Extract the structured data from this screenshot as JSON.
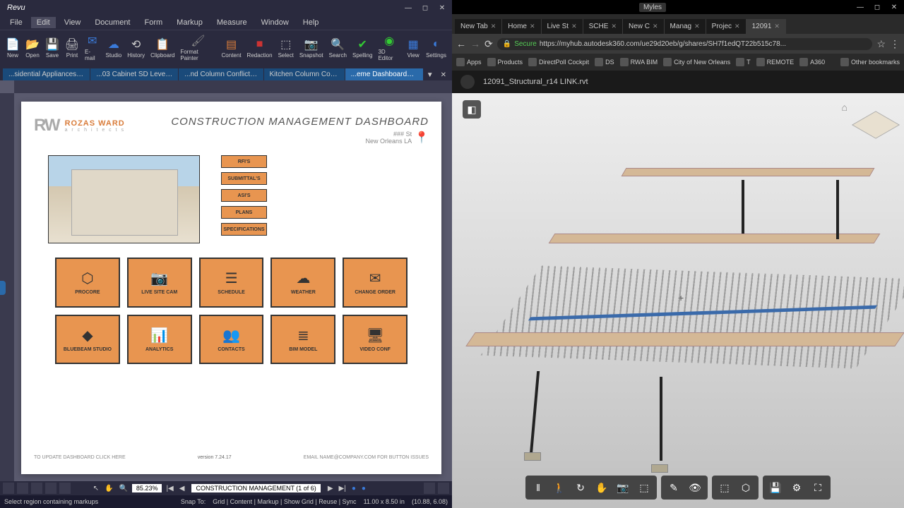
{
  "revu": {
    "app": "Revu",
    "menu": [
      "File",
      "Edit",
      "View",
      "Document",
      "Form",
      "Markup",
      "Measure",
      "Window",
      "Help"
    ],
    "toolbar": [
      {
        "label": "New",
        "icon": "📄",
        "color": "#ffcc33"
      },
      {
        "label": "Open",
        "icon": "📂",
        "color": "#d97c3a"
      },
      {
        "label": "Save",
        "icon": "💾",
        "color": "#3a7ad9"
      },
      {
        "label": "Print",
        "icon": "🖨",
        "color": "#ccc"
      },
      {
        "label": "E-mail",
        "icon": "✉",
        "color": "#3a7ad9"
      },
      {
        "label": "Studio",
        "icon": "☁",
        "color": "#3a7ad9"
      },
      {
        "label": "History",
        "icon": "⟲",
        "color": "#ccc"
      },
      {
        "label": "Clipboard",
        "icon": "📋",
        "color": "#d97c3a"
      },
      {
        "label": "Format Painter",
        "icon": "🖌",
        "color": "#888"
      },
      {
        "label": "Content",
        "icon": "▤",
        "color": "#d97c3a"
      },
      {
        "label": "Redaction",
        "icon": "■",
        "color": "#c33"
      },
      {
        "label": "Select",
        "icon": "⬚",
        "color": "#ccc"
      },
      {
        "label": "Snapshot",
        "icon": "📷",
        "color": "#3a7ad9"
      },
      {
        "label": "Search",
        "icon": "🔍",
        "color": "#3a7ad9"
      },
      {
        "label": "Spelling",
        "icon": "✔",
        "color": "#3c3"
      },
      {
        "label": "3D Editor",
        "icon": "◉",
        "color": "#3c3"
      },
      {
        "label": "View",
        "icon": "▦",
        "color": "#3a7ad9"
      },
      {
        "label": "Settings",
        "icon": "◐",
        "color": "#3a7ad9"
      }
    ],
    "tabs": [
      "...sidential Appliances PD*",
      "...03 Cabinet SD Level 2-5",
      "...nd Column Conflict _1_",
      "Kitchen Column Conflict",
      "...eme Dashboards_LI*"
    ],
    "active_tab": 4,
    "dashboard": {
      "logo_name": "ROZAS WARD",
      "logo_sub": "a r c h i t e c t s",
      "title": "CONSTRUCTION MANAGEMENT DASHBOARD",
      "addr1": "### St",
      "addr2": "New Orleans LA",
      "links": [
        "RFI'S",
        "SUBMITTAL'S",
        "ASI'S",
        "PLANS",
        "SPECIFICATIONS"
      ],
      "cards": [
        {
          "label": "PROCORE",
          "icon": "⬡"
        },
        {
          "label": "LIVE SITE CAM",
          "icon": "📷"
        },
        {
          "label": "SCHEDULE",
          "icon": "☰"
        },
        {
          "label": "WEATHER",
          "icon": "☁"
        },
        {
          "label": "CHANGE ORDER",
          "icon": "✉"
        },
        {
          "label": "BLUEBEAM STUDIO",
          "icon": "◆"
        },
        {
          "label": "ANALYTICS",
          "icon": "📊"
        },
        {
          "label": "CONTACTS",
          "icon": "👥"
        },
        {
          "label": "BIM MODEL",
          "icon": "≣"
        },
        {
          "label": "VIDEO CONF",
          "icon": "🖥"
        }
      ],
      "update": "TO UPDATE DASHBOARD CLICK HERE",
      "version": "version 7.24.17",
      "email": "EMAIL NAME@COMPANY.COM FOR BUTTON ISSUES"
    },
    "zoom": "85.23%",
    "page": "CONSTRUCTION MANAGEMENT (1 of 6)",
    "status": "Select region containing markups",
    "snap": "Snap To:",
    "snap_items": [
      "Grid",
      "Content",
      "Markup",
      "Show Grid",
      "Reuse",
      "Sync"
    ],
    "dims": "11.00 x 8.50 in",
    "coords": "(10.88, 6.08)"
  },
  "chrome": {
    "user": "Myles",
    "tabs": [
      "New Tab",
      "Home",
      "Live St",
      "SCHE",
      "New C",
      "Manag",
      "Projec",
      "12091"
    ],
    "active_tab": 7,
    "url_secure": "Secure",
    "url": "https://myhub.autodesk360.com/ue29d20eb/g/shares/SH7f1edQT22b515c78...",
    "bookmarks": [
      "Apps",
      "Products",
      "DirectPoll Cockpit",
      "DS",
      "RWA BIM",
      "City of New Orleans",
      "T",
      "REMOTE",
      "A360"
    ],
    "other": "Other bookmarks",
    "file": "12091_Structural_r14 LINK.rvt",
    "vtools": [
      "‖",
      "🚶",
      "↻",
      "✋",
      "📷",
      "⬚",
      "✎",
      "👁",
      "⬚",
      "⬡",
      "💾",
      "⚙",
      "⛶"
    ]
  }
}
